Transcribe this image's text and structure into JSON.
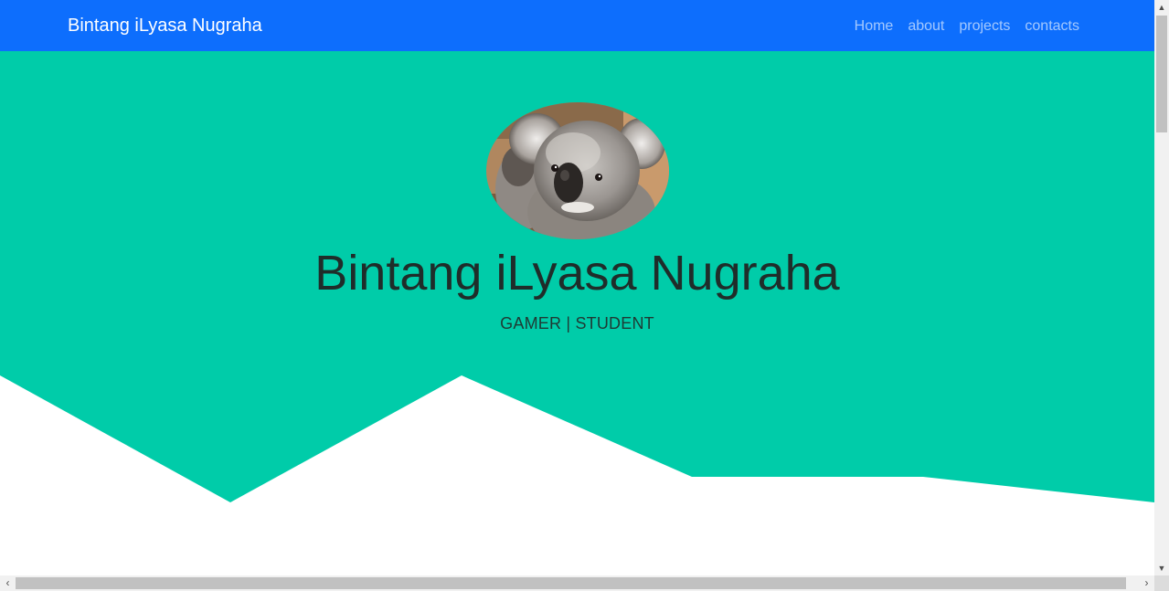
{
  "navbar": {
    "brand": "Bintang iLyasa Nugraha",
    "links": [
      "Home",
      "about",
      "projects",
      "contacts"
    ]
  },
  "hero": {
    "name": "Bintang iLyasa Nugraha",
    "tagline": "GAMER | STUDENT",
    "avatar_subject": "koala-photo"
  },
  "colors": {
    "navbar_bg": "#0d6efd",
    "hero_bg": "#00cca9",
    "page_bg": "#ffffff"
  }
}
